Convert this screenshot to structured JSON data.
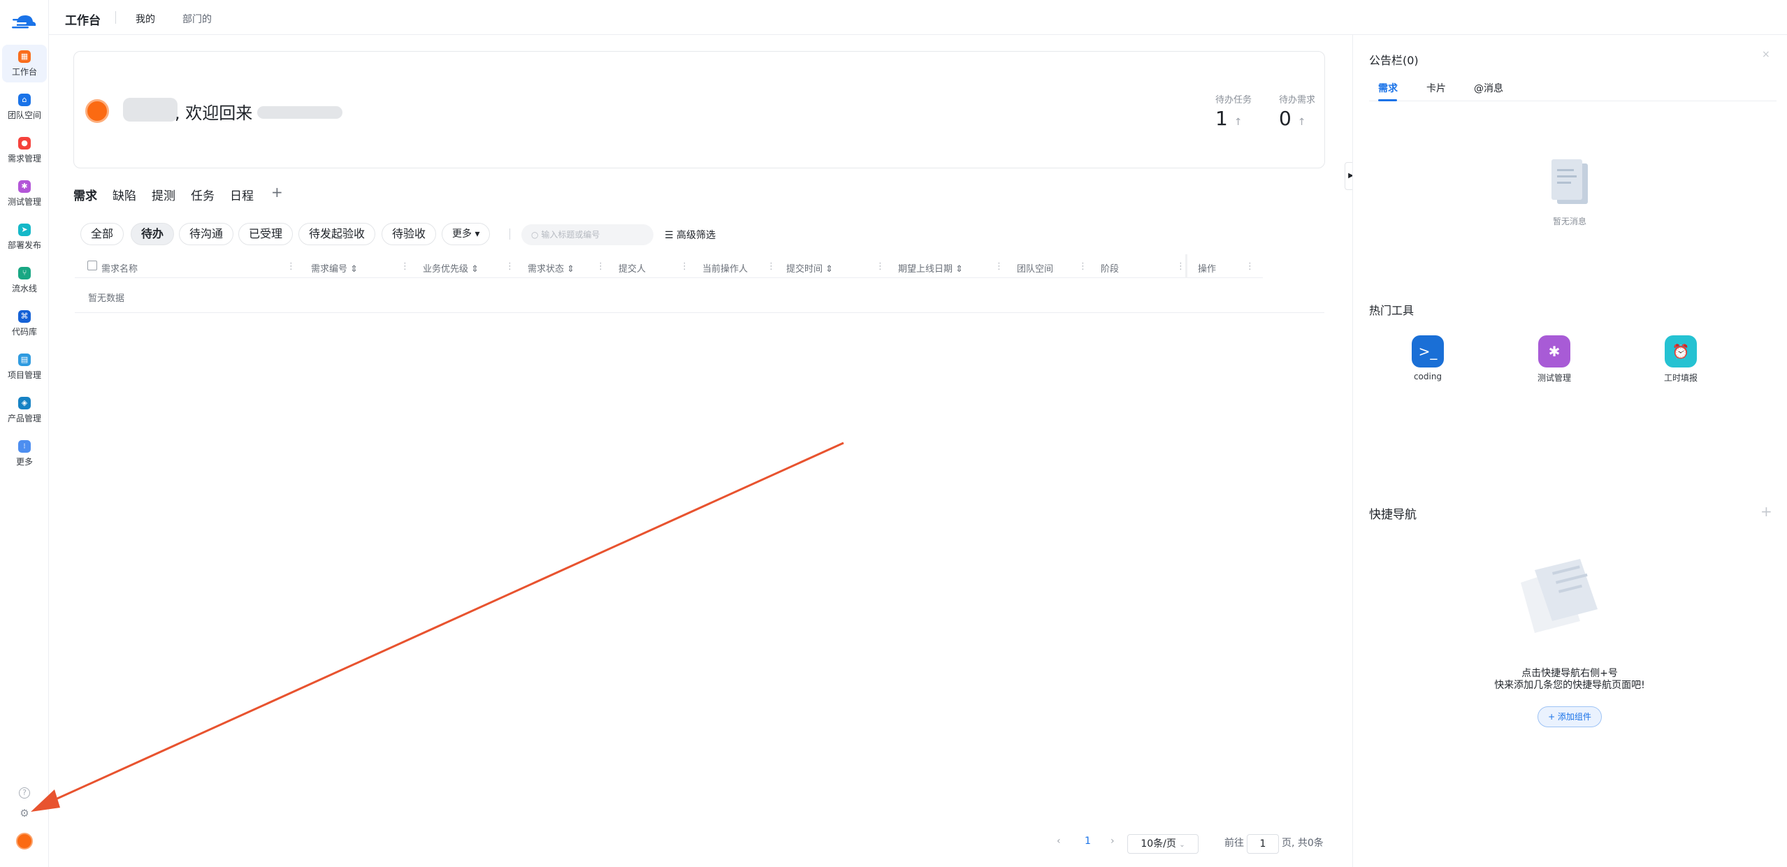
{
  "rail": {
    "items": [
      {
        "label": "工作台",
        "icon": "grid-icon",
        "color": "#f96d1d",
        "active": true
      },
      {
        "label": "团队空间",
        "icon": "team-space-icon",
        "color": "#1a73e8"
      },
      {
        "label": "需求管理",
        "icon": "requirement-icon",
        "color": "#f5423c"
      },
      {
        "label": "测试管理",
        "icon": "test-icon",
        "color": "#b356d8"
      },
      {
        "label": "部署发布",
        "icon": "deploy-icon",
        "color": "#14b8c8"
      },
      {
        "label": "流水线",
        "icon": "pipeline-icon",
        "color": "#19a783"
      },
      {
        "label": "代码库",
        "icon": "code-repo-icon",
        "color": "#1561d6"
      },
      {
        "label": "项目管理",
        "icon": "project-icon",
        "color": "#2f9be0"
      },
      {
        "label": "产品管理",
        "icon": "product-icon",
        "color": "#1682c4"
      },
      {
        "label": "更多",
        "icon": "more-apps-icon",
        "color": "#4d8ef0"
      }
    ],
    "help_glyph": "?",
    "settings_glyph": "⚙"
  },
  "topbar": {
    "title": "工作台",
    "tabs": [
      "我的",
      "部门的"
    ]
  },
  "welcome": {
    "greeting": ", 欢迎回来",
    "stats": [
      {
        "label": "待办任务",
        "value": "1",
        "arrow": "↑"
      },
      {
        "label": "待办需求",
        "value": "0",
        "arrow": "↑"
      }
    ]
  },
  "module_tabs": [
    "需求",
    "缺陷",
    "提测",
    "任务",
    "日程",
    "+"
  ],
  "filters": {
    "chips": [
      "全部",
      "待办",
      "待沟通",
      "已受理",
      "待发起验收",
      "待验收",
      "更多 ▾"
    ],
    "active_chip": "待办",
    "search_placeholder": "输入标题或编号",
    "advanced_label": "高级筛选"
  },
  "table": {
    "columns": [
      "需求名称",
      "需求编号",
      "业务优先级",
      "需求状态",
      "提交人",
      "当前操作人",
      "提交时间",
      "期望上线日期",
      "团队空间",
      "阶段",
      "操作"
    ],
    "empty_text": "暂无数据"
  },
  "pagination": {
    "prev": "‹",
    "current_page": "1",
    "next": "›",
    "page_size": "10条/页",
    "goto_label": "前往",
    "goto_value": "1",
    "suffix": "页, 共0条"
  },
  "right_panel": {
    "bulletin_title": "公告栏(0)",
    "close": "×",
    "tabs": [
      "需求",
      "卡片",
      "@消息"
    ],
    "empty_message": "暂无消息",
    "hot_tools_title": "热门工具",
    "tools": [
      {
        "label": "coding",
        "icon": "terminal-icon",
        "color": "#1a6fd6",
        "glyph": ">_"
      },
      {
        "label": "测试管理",
        "icon": "bug-icon",
        "color": "#a85bd6",
        "glyph": "✱"
      },
      {
        "label": "工时填报",
        "icon": "alarm-clock-icon",
        "color": "#25c2d2",
        "glyph": "⏰"
      }
    ],
    "quick_nav_title": "快捷导航",
    "quick_nav_plus": "+",
    "quick_nav_hint_1": "点击快捷导航右侧+号",
    "quick_nav_hint_2": "快来添加几条您的快捷导航页面吧!",
    "add_widget_label": "+ 添加组件"
  },
  "colors": {
    "accent": "#1a73e8",
    "avatar": "#fb6a12",
    "annotation_arrow": "#e8532f"
  }
}
